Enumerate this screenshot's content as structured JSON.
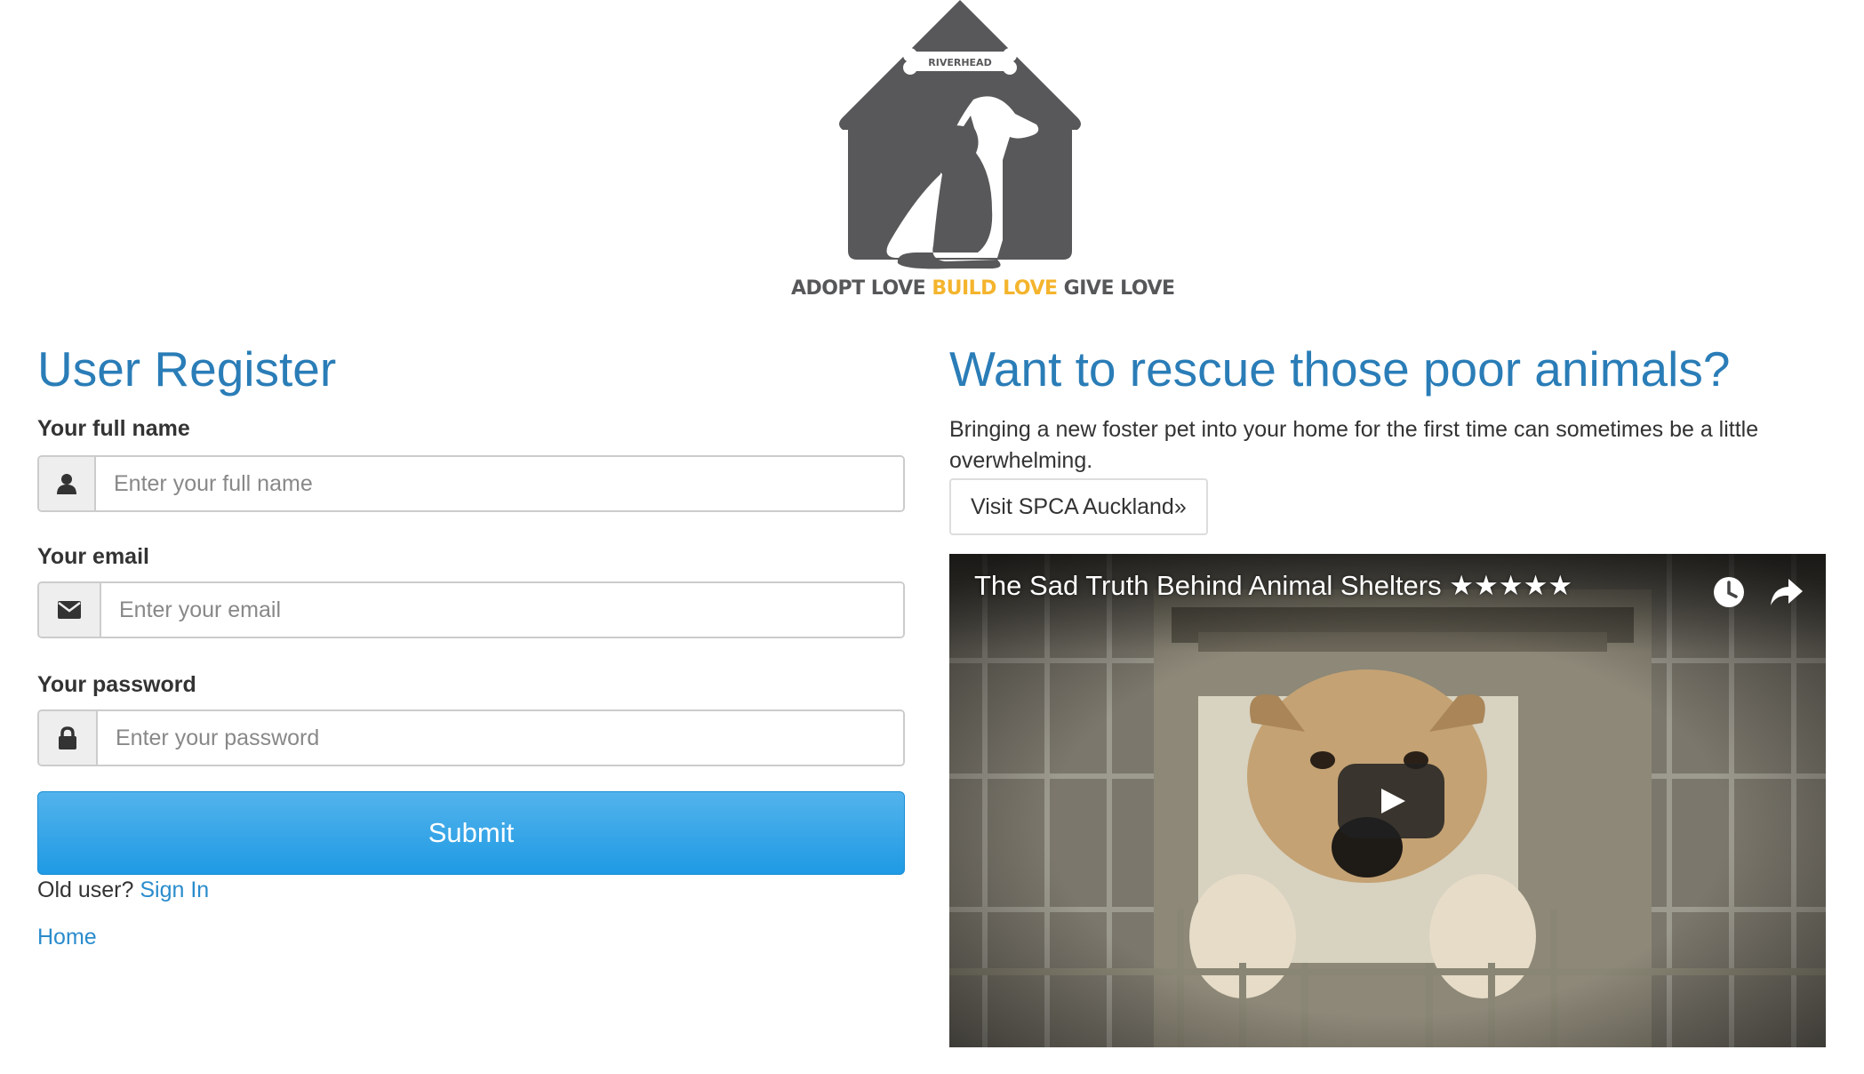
{
  "logo": {
    "badge_text": "RIVERHEAD",
    "tagline_part1": "ADOPT LOVE ",
    "tagline_part2": "BUILD LOVE",
    "tagline_part3": " GIVE LOVE",
    "colors": {
      "house": "#58585a",
      "highlight": "#f4b42d"
    }
  },
  "register": {
    "title": "User Register",
    "fields": [
      {
        "label": "Your full name",
        "placeholder": "Enter your full name",
        "icon": "user-icon"
      },
      {
        "label": "Your email",
        "placeholder": "Enter your email",
        "icon": "envelope-icon"
      },
      {
        "label": "Your password",
        "placeholder": "Enter your password",
        "icon": "lock-icon"
      }
    ],
    "submit_label": "Submit",
    "old_user_text": "Old user? ",
    "sign_in_label": "Sign In",
    "home_label": "Home"
  },
  "promo": {
    "title": "Want to rescue those poor animals?",
    "description": "Bringing a new foster pet into your home for the first time can sometimes be a little overwhelming.",
    "visit_button_label": "Visit SPCA Auckland»"
  },
  "video": {
    "title": "The Sad Truth Behind Animal Shelters ★★★★★",
    "icons": [
      "watch-later-icon",
      "share-icon",
      "play-icon"
    ]
  },
  "colors": {
    "heading": "#2a7db7",
    "link": "#2a8ccd",
    "submit": "#1f9ae4"
  }
}
